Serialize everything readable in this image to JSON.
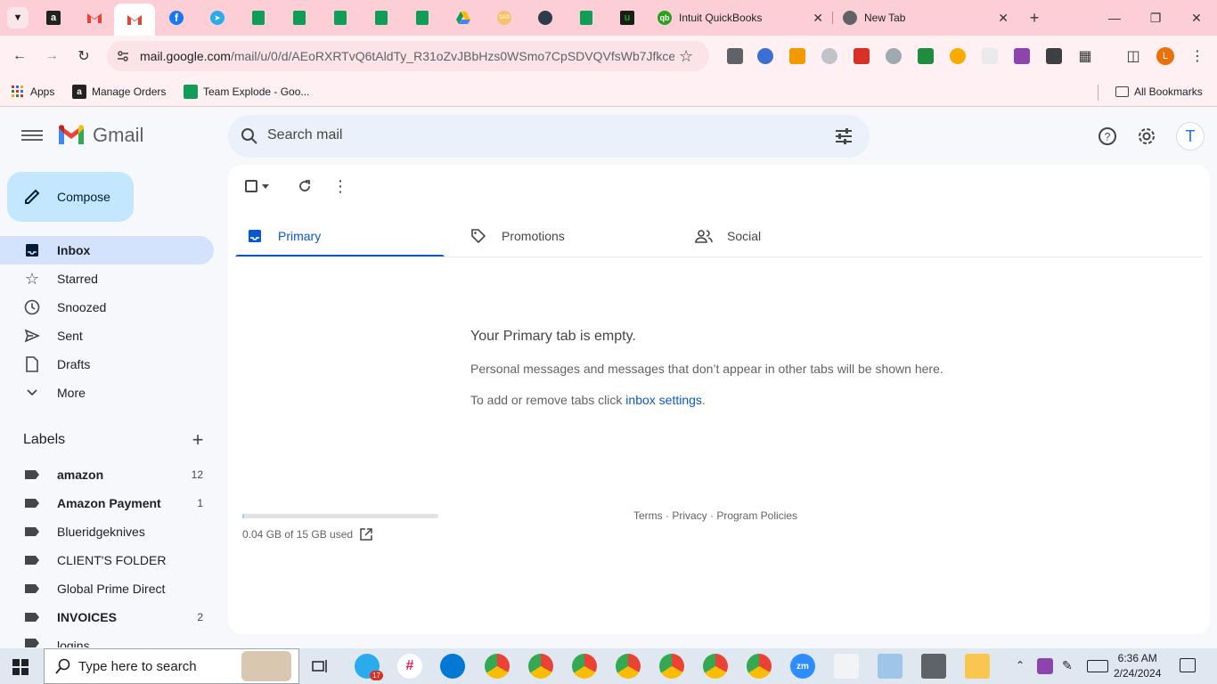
{
  "browser": {
    "tabs": [
      {
        "label": "Intuit QuickBooks"
      },
      {
        "label": "New Tab"
      }
    ],
    "url_host": "mail.google.com",
    "url_rest": "/mail/u/0/d/AEoRXRTvQ6tAldTy_R31oZvJBbHzs0WSmo7CpSDVQVfsWb7Jfkce/...",
    "profile_initial": "L",
    "bookmarks": {
      "apps": "Apps",
      "manage_orders": "Manage Orders",
      "team_explode": "Team Explode - Goo...",
      "all": "All Bookmarks"
    }
  },
  "gmail": {
    "brand": "Gmail",
    "search_placeholder": "Search mail",
    "avatar_initial": "T",
    "compose": "Compose",
    "nav": [
      {
        "label": "Inbox"
      },
      {
        "label": "Starred"
      },
      {
        "label": "Snoozed"
      },
      {
        "label": "Sent"
      },
      {
        "label": "Drafts"
      },
      {
        "label": "More"
      }
    ],
    "labels_title": "Labels",
    "labels": [
      {
        "name": "amazon",
        "count": "12",
        "bold": true
      },
      {
        "name": "Amazon Payment",
        "count": "1",
        "bold": true
      },
      {
        "name": "Blueridgeknives",
        "count": "",
        "bold": false
      },
      {
        "name": "CLIENT'S FOLDER",
        "count": "",
        "bold": false
      },
      {
        "name": "Global Prime Direct",
        "count": "",
        "bold": false
      },
      {
        "name": "INVOICES",
        "count": "2",
        "bold": true
      },
      {
        "name": "logins",
        "count": "",
        "bold": false
      }
    ],
    "tabs": [
      {
        "label": "Primary"
      },
      {
        "label": "Promotions"
      },
      {
        "label": "Social"
      }
    ],
    "empty_title": "Your Primary tab is empty.",
    "empty_desc": "Personal messages and messages that don’t appear in other tabs will be shown here.",
    "empty_settings_prefix": "To add or remove tabs click ",
    "empty_settings_link": "inbox settings",
    "empty_settings_suffix": ".",
    "storage_text": "0.04 GB of 15 GB used",
    "storage_fraction": 0.003,
    "footer": "Terms · Privacy · Program Policies"
  },
  "taskbar": {
    "search_placeholder": "Type here to search",
    "telegram_badge": "17",
    "zoom_label": "zm",
    "time": "6:36 AM",
    "date": "2/24/2024"
  },
  "colors": {
    "accent": "#0b57d0",
    "tab_strip": "#fccfd6",
    "compose": "#c2e7ff",
    "inbox_active": "#d3e3fd"
  }
}
